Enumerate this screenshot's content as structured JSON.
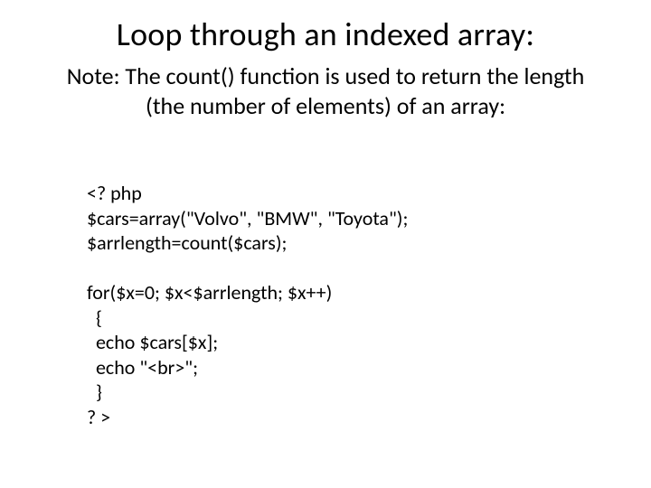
{
  "title": "Loop through an indexed array:",
  "subtitle": "Note: The count() function is used to return the length (the number of elements) of an array:",
  "code": "<? php\n$cars=array(\"Volvo\", \"BMW\", \"Toyota\");\n$arrlength=count($cars);\n\nfor($x=0; $x<$arrlength; $x++)\n  {\n  echo $cars[$x];\n  echo \"<br>\";\n  }\n? >"
}
